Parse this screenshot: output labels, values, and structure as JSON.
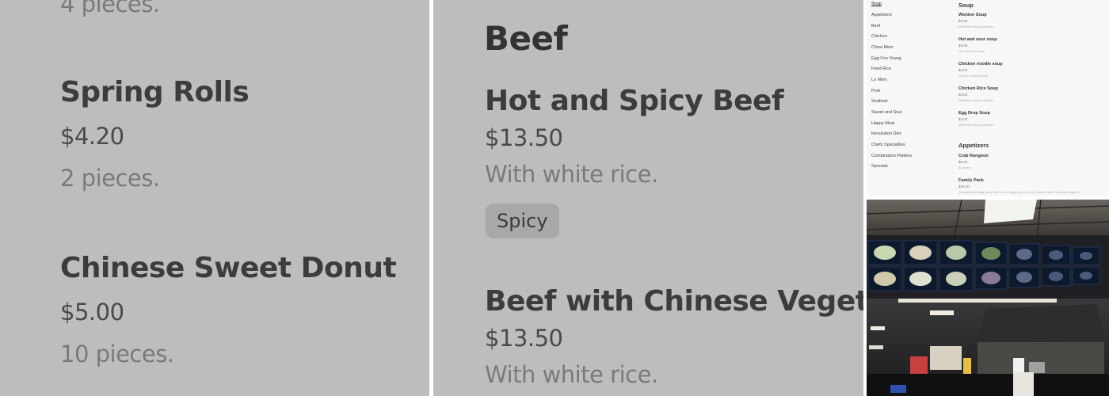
{
  "left_zoom": {
    "partial_top": "4 pieces.",
    "items": [
      {
        "name": "Spring Rolls",
        "price": "$4.20",
        "desc": "2 pieces."
      },
      {
        "name": "Chinese Sweet Donut",
        "price": "$5.00",
        "desc": "10 pieces."
      }
    ]
  },
  "mid_zoom": {
    "section": "Beef",
    "items": [
      {
        "name": "Hot and Spicy Beef",
        "price": "$13.50",
        "desc": "With white rice.",
        "tag": "Spicy"
      },
      {
        "name": "Beef with Chinese Vegetables",
        "price": "$13.50",
        "desc": "With white rice."
      }
    ]
  },
  "menu": {
    "categories": [
      "Soup",
      "Appetizers",
      "Beef",
      "Chicken",
      "Chow Mein",
      "Egg Foo Young",
      "Fried Rice",
      "Lo Mein",
      "Pork",
      "Seafood",
      "Sweet and Sour",
      "Happy Meal",
      "Revolution Diet",
      "Chefs Specialties",
      "Combination Platters",
      "Specials"
    ],
    "active_category": "Soup",
    "soup": {
      "title": "Soup",
      "items": [
        {
          "name": "Wonton Soup",
          "price": "$3.00",
          "desc": "With fried crispy noodles."
        },
        {
          "name": "Hot and sour soup",
          "price": "$4.00",
          "desc": "Hot and sour soup."
        },
        {
          "name": "Chicken noodle soup",
          "price": "$3.00",
          "desc": "Chicken noodle soup."
        },
        {
          "name": "Chicken Rice Soup",
          "price": "$3.00",
          "desc": "With fried crispy noodles."
        },
        {
          "name": "Egg Drop Soup",
          "price": "$3.00",
          "desc": "With fried crispy noodles."
        }
      ]
    },
    "appetizers": {
      "title": "Appetizers",
      "items": [
        {
          "name": "Crab Rangoon",
          "price": "$5.20",
          "desc": "8 pieces."
        },
        {
          "name": "Family Pack",
          "price": "$28.00",
          "desc": "Choose from large pork fried rice or large pork lo mein. Served with 4 chicken wings, 8"
        }
      ]
    }
  },
  "colors": {
    "zoom_bg": "#bdbdbd",
    "menu_bg": "#f7f7f7",
    "photo_bg": "#1a1714"
  }
}
